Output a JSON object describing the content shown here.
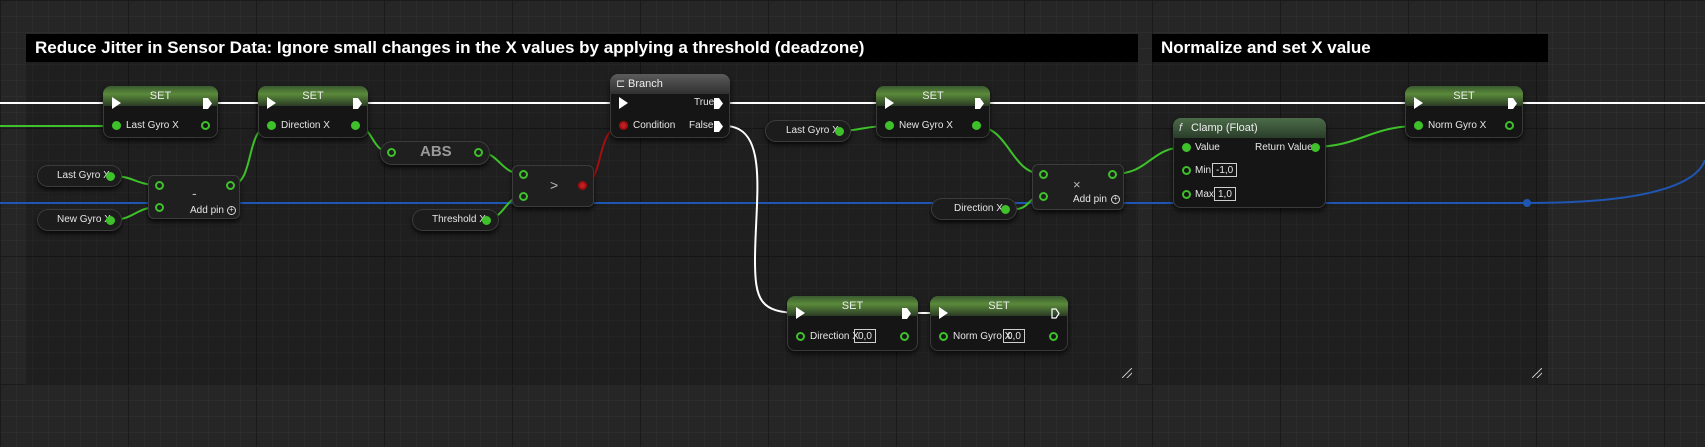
{
  "comments": [
    {
      "title": "Reduce Jitter in Sensor Data: Ignore small changes in the X values by applying a threshold (deadzone)"
    },
    {
      "title": "Normalize and set X value"
    }
  ],
  "colors": {
    "exec": "#ffffff",
    "float": "#3ec12a",
    "bool": "#a01010",
    "struct": "#1f56b3"
  },
  "nodes": {
    "set1": {
      "header": "SET",
      "pin": "Last Gyro X"
    },
    "set2": {
      "header": "SET",
      "pin": "Direction X"
    },
    "set3": {
      "header": "SET",
      "pin": "New Gyro X"
    },
    "set4": {
      "header": "SET",
      "pin": "Norm Gyro X"
    },
    "set5": {
      "header": "SET",
      "pin": "Direction X",
      "value": "0,0"
    },
    "set6": {
      "header": "SET",
      "pin": "Norm Gyro X",
      "value": "0,0"
    },
    "branch": {
      "header": "Branch",
      "true_label": "True",
      "false_label": "False",
      "condition_label": "Condition"
    },
    "subtract": {
      "symbol": "-",
      "add_pin": "Add pin"
    },
    "multiply": {
      "symbol": "×",
      "add_pin": "Add pin"
    },
    "abs": {
      "label": "ABS"
    },
    "greater": {
      "symbol": ">"
    },
    "clamp": {
      "header": "Clamp (Float)",
      "value_label": "Value",
      "return_label": "Return Value",
      "min_label": "Min",
      "min_value": "-1,0",
      "max_label": "Max",
      "max_value": "1,0"
    }
  },
  "getters": {
    "g_last1": "Last Gyro X",
    "g_new1": "New Gyro X",
    "g_threshold": "Threshold X",
    "g_last2": "Last Gyro X",
    "g_direction": "Direction X"
  }
}
